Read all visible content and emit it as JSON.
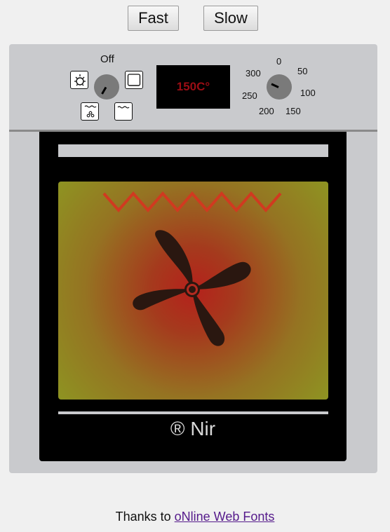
{
  "controls": {
    "fast_label": "Fast",
    "slow_label": "Slow"
  },
  "panel": {
    "mode_label": "Off",
    "display_value": "150C°",
    "temperature_scale": [
      {
        "label": "0"
      },
      {
        "label": "50"
      },
      {
        "label": "100"
      },
      {
        "label": "150"
      },
      {
        "label": "200"
      },
      {
        "label": "250"
      },
      {
        "label": "300"
      }
    ],
    "mode_icons": [
      "light-icon",
      "grill-icon",
      "fan-icon",
      "top-heat-icon"
    ]
  },
  "oven": {
    "brand": "® Nir",
    "colors": {
      "body": "#c9cacd",
      "door": "#000000",
      "display_text": "#9b0d14",
      "heating_element": "#d03a20",
      "fan": "#2a1710"
    }
  },
  "footer": {
    "thanks_text": "Thanks to",
    "link_text": "oNline Web Fonts"
  }
}
